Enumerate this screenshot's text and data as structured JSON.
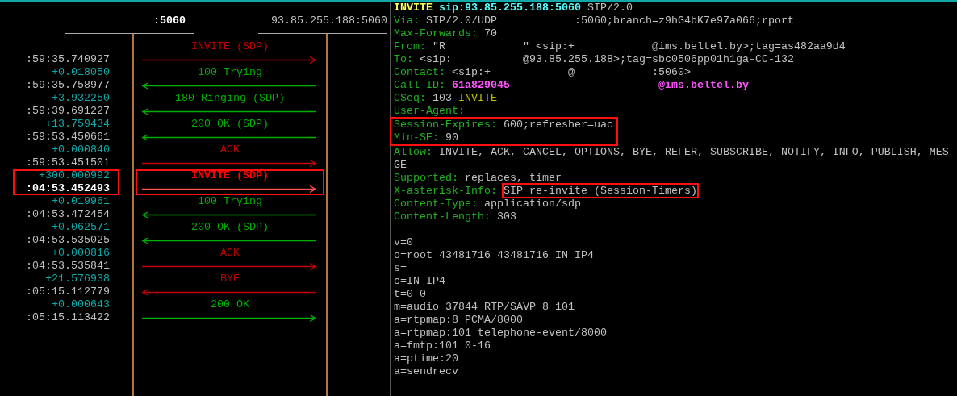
{
  "call_flow": {
    "endpoints": [
      {
        "label": ":5060",
        "bold": true
      },
      {
        "label": "93.85.255.188:5060",
        "bold": false
      }
    ],
    "messages": [
      {
        "label": "INVITE (SDP)",
        "color": "#c00000",
        "to_left": false,
        "time": ":59:35.740927",
        "selected": false,
        "highlighted": false
      },
      {
        "label": "100 Trying",
        "color": "#00b000",
        "to_left": true,
        "delta": "+0.018050",
        "time": ":59:35.758977",
        "selected": false,
        "highlighted": false
      },
      {
        "label": "180 Ringing (SDP)",
        "color": "#00b000",
        "to_left": true,
        "delta": "+3.932250",
        "time": ":59:39.691227",
        "selected": false,
        "highlighted": false
      },
      {
        "label": "200 OK (SDP)",
        "color": "#00b000",
        "to_left": true,
        "delta": "+13.759434",
        "time": ":59:53.450661",
        "selected": false,
        "highlighted": false
      },
      {
        "label": "ACK",
        "color": "#c00000",
        "to_left": false,
        "delta": "+0.000840",
        "time": ":59:53.451501",
        "selected": false,
        "highlighted": false
      },
      {
        "label": "INVITE (SDP)",
        "color": "#c00000",
        "to_left": false,
        "delta": "+300.000992",
        "time": ":04:53.452493",
        "selected": true,
        "highlighted": true
      },
      {
        "label": "100 Trying",
        "color": "#00b000",
        "to_left": true,
        "delta": "+0.019961",
        "time": ":04:53.472454",
        "selected": false,
        "highlighted": false
      },
      {
        "label": "200 OK (SDP)",
        "color": "#00b000",
        "to_left": true,
        "delta": "+0.062571",
        "time": ":04:53.535025",
        "selected": false,
        "highlighted": false
      },
      {
        "label": "ACK",
        "color": "#c00000",
        "to_left": false,
        "delta": "+0.000816",
        "time": ":04:53.535841",
        "selected": false,
        "highlighted": false
      },
      {
        "label": "BYE",
        "color": "#c00000",
        "to_left": true,
        "delta": "+21.576938",
        "time": ":05:15.112779",
        "selected": false,
        "highlighted": false
      },
      {
        "label": "200 OK",
        "color": "#00b000",
        "to_left": false,
        "delta": "+0.000643",
        "time": ":05:15.113422",
        "selected": false,
        "highlighted": false
      }
    ]
  },
  "message_detail": {
    "lines": [
      {
        "kind": "text",
        "segments": [
          {
            "text": "INVITE",
            "color": "#ffff55",
            "bold": true
          },
          {
            "text": "sip:93.85.255.188:5060",
            "color": "#55ffff",
            "bold": true
          },
          {
            "text": "SIP/2.0",
            "color": "#c0c0c0"
          }
        ]
      },
      {
        "kind": "text",
        "segments": [
          {
            "text": "Via:",
            "color": "#20b020"
          },
          {
            "text": "SIP/2.0/UDP            :5060;branch=z9hG4bK7e97a066;rport",
            "color": "#c0c0c0"
          }
        ]
      },
      {
        "kind": "text",
        "segments": [
          {
            "text": "Max-Forwards:",
            "color": "#20b020"
          },
          {
            "text": "70",
            "color": "#c0c0c0"
          }
        ]
      },
      {
        "kind": "text",
        "segments": [
          {
            "text": "From:",
            "color": "#20b020"
          },
          {
            "text": "\"R            \" <sip:+            @ims.beltel.by>;tag=as482aa9d4",
            "color": "#c0c0c0"
          }
        ]
      },
      {
        "kind": "text",
        "segments": [
          {
            "text": "To:",
            "color": "#20b020"
          },
          {
            "text": "<sip:           @93.85.255.188>;tag=sbc0506pp01h1ga-CC-132",
            "color": "#c0c0c0"
          }
        ]
      },
      {
        "kind": "text",
        "segments": [
          {
            "text": "Contact:",
            "color": "#20b020"
          },
          {
            "text": "<sip:+            @            :5060>",
            "color": "#c0c0c0"
          }
        ]
      },
      {
        "kind": "text",
        "segments": [
          {
            "text": "Call-ID:",
            "color": "#20b020"
          },
          {
            "text": "61a829045                       @ims.beltel.by",
            "color": "#ff55ff",
            "bold": true
          }
        ]
      },
      {
        "kind": "text",
        "segments": [
          {
            "text": "CSeq:",
            "color": "#20b020"
          },
          {
            "text": "103",
            "color": "#c0c0c0"
          },
          {
            "text": "INVITE",
            "color": "#c0c000"
          }
        ]
      },
      {
        "kind": "text",
        "segments": [
          {
            "text": "User-Agent:",
            "color": "#20b020"
          }
        ]
      },
      {
        "kind": "text",
        "boxed": true,
        "segments": [
          {
            "text": "Session-Expires:",
            "color": "#20b020"
          },
          {
            "text": "600;refresher=uac",
            "color": "#c0c0c0"
          }
        ]
      },
      {
        "kind": "text",
        "boxed": true,
        "segments": [
          {
            "text": "Min-SE:",
            "color": "#20b020"
          },
          {
            "text": "90",
            "color": "#c0c0c0"
          }
        ]
      },
      {
        "kind": "text",
        "segments": [
          {
            "text": "Allow:",
            "color": "#20b020"
          },
          {
            "text": "INVITE, ACK, CANCEL, OPTIONS, BYE, REFER, SUBSCRIBE, NOTIFY, INFO, PUBLISH, MES",
            "color": "#c0c0c0"
          }
        ]
      },
      {
        "kind": "text",
        "segments": [
          {
            "text": "GE",
            "color": "#c0c0c0"
          }
        ]
      },
      {
        "kind": "text",
        "segments": [
          {
            "text": "Supported:",
            "color": "#20b020"
          },
          {
            "text": "replaces, timer",
            "color": "#c0c0c0"
          }
        ]
      },
      {
        "kind": "text",
        "segments": [
          {
            "text": "X-asterisk-Info:",
            "color": "#20b020"
          },
          {
            "text": "SIP re-invite (Session-Timers)",
            "color": "#c0c0c0",
            "boxed": true
          }
        ]
      },
      {
        "kind": "text",
        "segments": [
          {
            "text": "Content-Type:",
            "color": "#20b020"
          },
          {
            "text": "application/sdp",
            "color": "#c0c0c0"
          }
        ]
      },
      {
        "kind": "text",
        "segments": [
          {
            "text": "Content-Length:",
            "color": "#20b020"
          },
          {
            "text": "303",
            "color": "#c0c0c0"
          }
        ]
      },
      {
        "kind": "blank"
      },
      {
        "kind": "text",
        "segments": [
          {
            "text": "v=0",
            "color": "#c0c0c0"
          }
        ]
      },
      {
        "kind": "text",
        "segments": [
          {
            "text": "o=root 43481716 43481716 IN IP4",
            "color": "#c0c0c0"
          }
        ]
      },
      {
        "kind": "text",
        "segments": [
          {
            "text": "s=",
            "color": "#c0c0c0"
          }
        ]
      },
      {
        "kind": "text",
        "segments": [
          {
            "text": "c=IN IP4",
            "color": "#c0c0c0"
          }
        ]
      },
      {
        "kind": "text",
        "segments": [
          {
            "text": "t=0 0",
            "color": "#c0c0c0"
          }
        ]
      },
      {
        "kind": "text",
        "segments": [
          {
            "text": "m=audio 37844 RTP/SAVP 8 101",
            "color": "#c0c0c0"
          }
        ]
      },
      {
        "kind": "text",
        "segments": [
          {
            "text": "a=rtpmap:8 PCMA/8000",
            "color": "#c0c0c0"
          }
        ]
      },
      {
        "kind": "text",
        "segments": [
          {
            "text": "a=rtpmap:101 telephone-event/8000",
            "color": "#c0c0c0"
          }
        ]
      },
      {
        "kind": "text",
        "segments": [
          {
            "text": "a=fmtp:101 0-16",
            "color": "#c0c0c0"
          }
        ]
      },
      {
        "kind": "text",
        "segments": [
          {
            "text": "a=ptime:20",
            "color": "#c0c0c0"
          }
        ]
      },
      {
        "kind": "text",
        "segments": [
          {
            "text": "a=sendrecv",
            "color": "#c0c0c0"
          }
        ]
      }
    ]
  }
}
